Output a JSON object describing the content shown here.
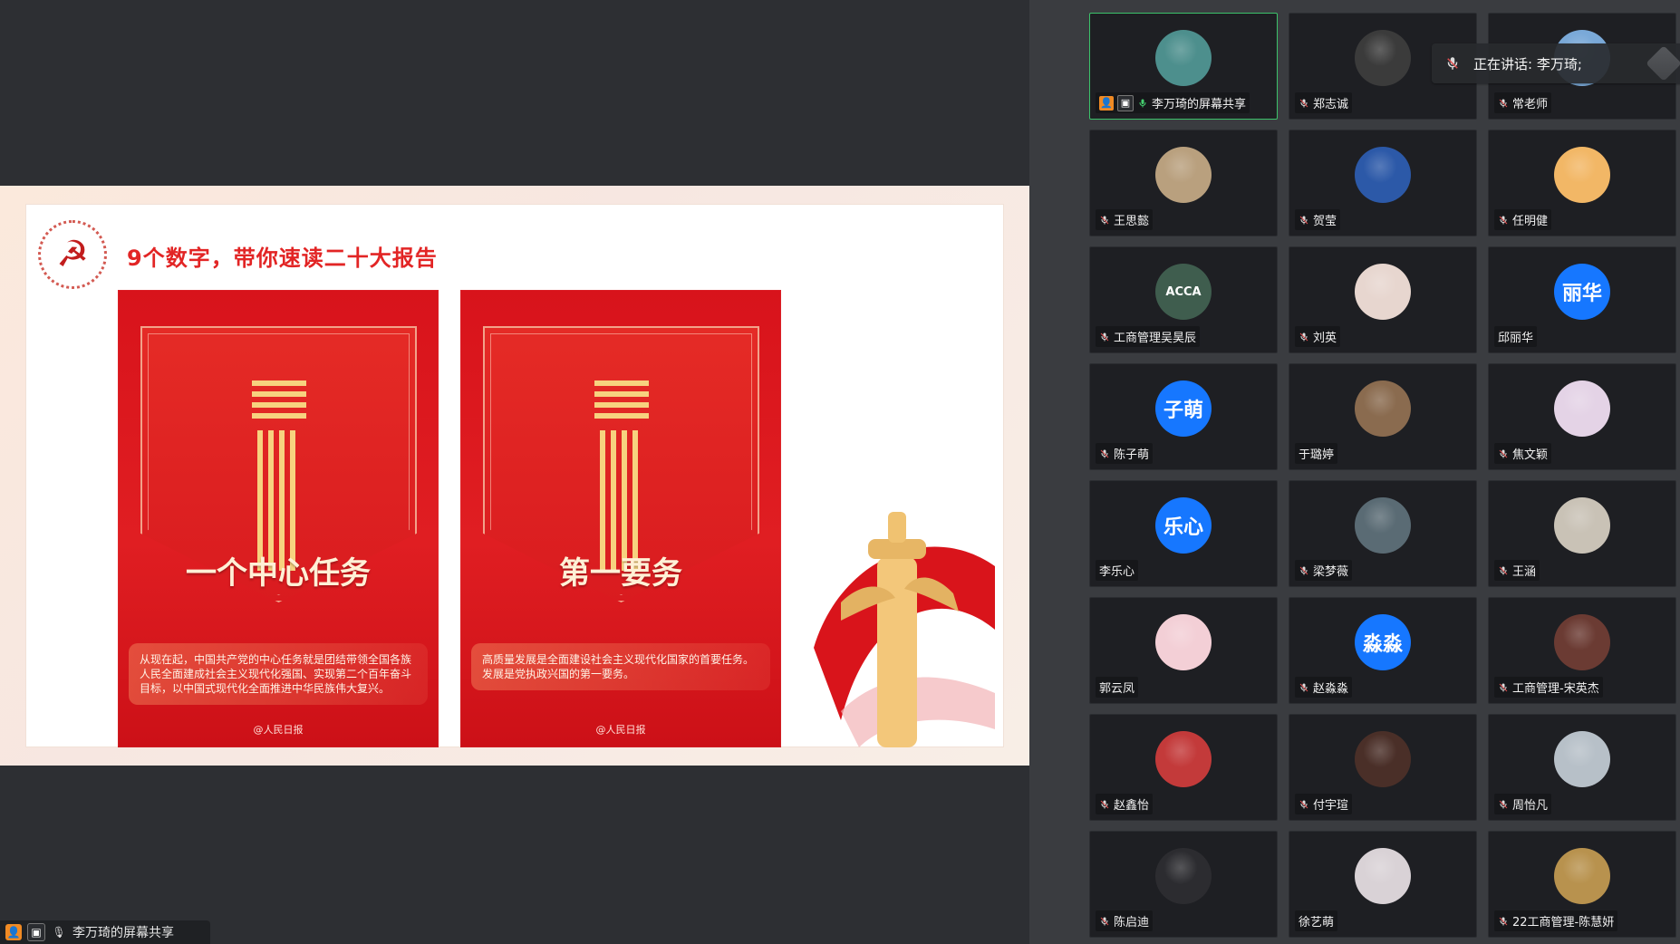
{
  "presentation": {
    "title": "9个数字，带你速读二十大报告",
    "posters": [
      {
        "caption": "一个中心任务",
        "description": "从现在起，中国共产党的中心任务就是团结带领全国各族人民全面建成社会主义现代化强国、实现第二个百年奋斗目标，以中国式现代化全面推进中华民族伟大复兴。",
        "footer": "@人民日报"
      },
      {
        "caption": "第一要务",
        "description": "高质量发展是全面建设社会主义现代化国家的首要任务。发展是党执政兴国的第一要务。",
        "footer": "@人民日报"
      }
    ],
    "colors": {
      "poster_red": "#d8131b",
      "title_red": "#e22525",
      "gold": "#f7d27f"
    }
  },
  "share_indicator": {
    "label": "李万琦的屏幕共享"
  },
  "speaking_toast": {
    "text": "正在讲话: 李万琦;"
  },
  "participants": [
    {
      "name": "李万琦的屏幕共享",
      "avatar_text": "",
      "avatar_color": "#4d8f8d",
      "muted": false,
      "active": true
    },
    {
      "name": "郑志诚",
      "avatar_text": "",
      "avatar_color": "#3b3b3b",
      "muted": true,
      "active": false
    },
    {
      "name": "常老师",
      "avatar_text": "",
      "avatar_color": "#7aa9d8",
      "muted": true,
      "active": false
    },
    {
      "name": "王思懿",
      "avatar_text": "",
      "avatar_color": "#b9a07e",
      "muted": true,
      "active": false
    },
    {
      "name": "贺莹",
      "avatar_text": "",
      "avatar_color": "#2c59a8",
      "muted": true,
      "active": false
    },
    {
      "name": "任明健",
      "avatar_text": "",
      "avatar_color": "#f2b766",
      "muted": true,
      "active": false
    },
    {
      "name": "工商管理吴昊辰",
      "avatar_text": "ACCA",
      "avatar_color": "#3f5d4e",
      "muted": true,
      "active": false
    },
    {
      "name": "刘英",
      "avatar_text": "",
      "avatar_color": "#e7d6cf",
      "muted": true,
      "active": false
    },
    {
      "name": "邱丽华",
      "avatar_text": "丽华",
      "avatar_color": "#1677ff",
      "muted": false,
      "active": false
    },
    {
      "name": "陈子萌",
      "avatar_text": "子萌",
      "avatar_color": "#1677ff",
      "muted": true,
      "active": false
    },
    {
      "name": "于璐婷",
      "avatar_text": "",
      "avatar_color": "#8a6b4f",
      "muted": false,
      "active": false
    },
    {
      "name": "焦文颖",
      "avatar_text": "",
      "avatar_color": "#e4d3e6",
      "muted": true,
      "active": false
    },
    {
      "name": "李乐心",
      "avatar_text": "乐心",
      "avatar_color": "#1677ff",
      "muted": false,
      "active": false
    },
    {
      "name": "梁梦薇",
      "avatar_text": "",
      "avatar_color": "#5a6b74",
      "muted": true,
      "active": false
    },
    {
      "name": "王涵",
      "avatar_text": "",
      "avatar_color": "#c9c2b6",
      "muted": true,
      "active": false
    },
    {
      "name": "郭云凤",
      "avatar_text": "",
      "avatar_color": "#f3cfd6",
      "muted": false,
      "active": false
    },
    {
      "name": "赵淼淼",
      "avatar_text": "淼淼",
      "avatar_color": "#1677ff",
      "muted": true,
      "active": false
    },
    {
      "name": "工商管理-宋英杰",
      "avatar_text": "",
      "avatar_color": "#6b3b33",
      "muted": true,
      "active": false
    },
    {
      "name": "赵鑫怡",
      "avatar_text": "",
      "avatar_color": "#c33a3a",
      "muted": true,
      "active": false
    },
    {
      "name": "付宇瑄",
      "avatar_text": "",
      "avatar_color": "#4a2f28",
      "muted": true,
      "active": false
    },
    {
      "name": "周怡凡",
      "avatar_text": "",
      "avatar_color": "#b7c0c8",
      "muted": true,
      "active": false
    },
    {
      "name": "陈启迪",
      "avatar_text": "",
      "avatar_color": "#2c2c30",
      "muted": true,
      "active": false
    },
    {
      "name": "徐艺萌",
      "avatar_text": "",
      "avatar_color": "#d9d2d6",
      "muted": false,
      "active": false
    },
    {
      "name": "22工商管理-陈慧妍",
      "avatar_text": "",
      "avatar_color": "#b8924e",
      "muted": true,
      "active": false
    }
  ]
}
